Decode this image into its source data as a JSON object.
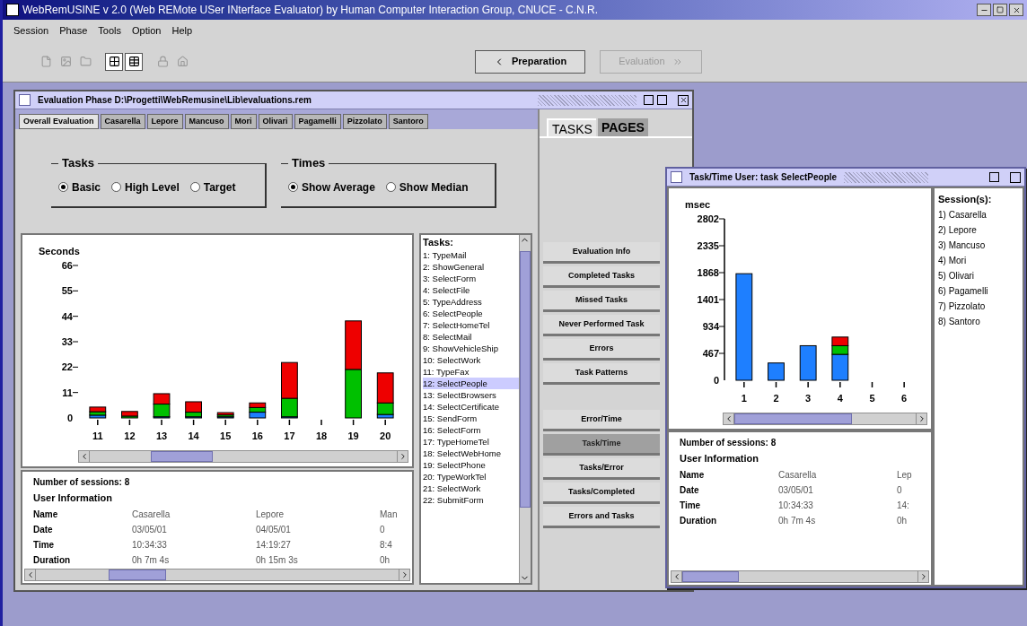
{
  "app": {
    "title": "WebRemUSINE v 2.0 (Web REMote USer INterface Evaluator) by Human Computer Interaction Group, CNUCE - C.N.R.",
    "menu": [
      "Session",
      "Phase",
      "Tools",
      "Option",
      "Help"
    ],
    "toolbar": [
      [
        {
          "disabled": true
        },
        {
          "disabled": true
        },
        {
          "disabled": true
        }
      ],
      [
        {
          "disabled": false
        },
        {
          "disabled": false
        }
      ],
      [
        {
          "disabled": true
        },
        {
          "disabled": true
        }
      ]
    ],
    "phase_buttons": [
      {
        "label": "Preparation",
        "kind": "back",
        "disabled": false
      },
      {
        "label": "Evaluation",
        "kind": "forward",
        "disabled": true
      }
    ]
  },
  "evaluation_window": {
    "title": "Evaluation Phase  D:\\Progetti\\WebRemusine\\Lib\\evaluations.rem",
    "tabs": [
      {
        "label": "Overall Evaluation",
        "selected": true
      },
      {
        "label": "Casarella",
        "selected": false
      },
      {
        "label": "Lepore",
        "selected": false
      },
      {
        "label": "Mancuso",
        "selected": false
      },
      {
        "label": "Mori",
        "selected": false
      },
      {
        "label": "Olivari",
        "selected": false
      },
      {
        "label": "Pagamelli",
        "selected": false
      },
      {
        "label": "Pizzolato",
        "selected": false
      },
      {
        "label": "Santoro",
        "selected": false
      }
    ],
    "tasks_group": {
      "label": "Tasks",
      "options": [
        {
          "label": "Basic",
          "selected": true
        },
        {
          "label": "High Level",
          "selected": false
        },
        {
          "label": "Target",
          "selected": false
        }
      ]
    },
    "times_group": {
      "label": "Times",
      "options": [
        {
          "label": "Show Average",
          "selected": true
        },
        {
          "label": "Show Median",
          "selected": false
        }
      ]
    },
    "chart_data": {
      "type": "bar",
      "stacked": true,
      "ylabel": "Seconds",
      "categories": [
        "11",
        "12",
        "13",
        "14",
        "15",
        "16",
        "17",
        "18",
        "19",
        "20"
      ],
      "ylim": [
        0,
        66
      ],
      "yticks": [
        0,
        11,
        22,
        33,
        44,
        55,
        66
      ],
      "series": [
        {
          "color": "#1e7fff",
          "values": [
            1.2,
            0,
            0.5,
            0.5,
            0.5,
            2.5,
            0.5,
            0,
            0,
            1.5
          ]
        },
        {
          "color": "#00c000",
          "values": [
            1.5,
            0.8,
            5.5,
            2,
            0.8,
            2,
            8,
            0,
            21,
            5
          ]
        },
        {
          "color": "#ee0000",
          "values": [
            2,
            2,
            4.5,
            4.5,
            1,
            2,
            15.5,
            0,
            21,
            13
          ]
        }
      ]
    },
    "task_list": {
      "title": "Tasks:",
      "items": [
        {
          "label": "1: TypeMail",
          "selected": false
        },
        {
          "label": "2: ShowGeneral",
          "selected": false
        },
        {
          "label": "3: SelectForm",
          "selected": false
        },
        {
          "label": "4: SelectFile",
          "selected": false
        },
        {
          "label": "5: TypeAddress",
          "selected": false
        },
        {
          "label": "6: SelectPeople",
          "selected": false
        },
        {
          "label": "7: SelectHomeTel",
          "selected": false
        },
        {
          "label": "8: SelectMail",
          "selected": false
        },
        {
          "label": "9: ShowVehicleShip",
          "selected": false
        },
        {
          "label": "10: SelectWork",
          "selected": false
        },
        {
          "label": "11: TypeFax",
          "selected": false
        },
        {
          "label": "12: SelectPeople",
          "selected": true
        },
        {
          "label": "13: SelectBrowsers",
          "selected": false
        },
        {
          "label": "14: SelectCertificate",
          "selected": false
        },
        {
          "label": "15: SendForm",
          "selected": false
        },
        {
          "label": "16: SelectForm",
          "selected": false
        },
        {
          "label": "17: TypeHomeTel",
          "selected": false
        },
        {
          "label": "18: SelectWebHome",
          "selected": false
        },
        {
          "label": "19: SelectPhone",
          "selected": false
        },
        {
          "label": "20: TypeWorkTel",
          "selected": false
        },
        {
          "label": "21: SelectWork",
          "selected": false
        },
        {
          "label": "22: SubmitForm",
          "selected": false
        }
      ]
    },
    "info": {
      "summary": "Number of sessions: 8",
      "heading": "User Information",
      "rows": [
        {
          "label": "Name",
          "values": [
            "Casarella",
            "Lepore",
            "Man"
          ]
        },
        {
          "label": "Date",
          "values": [
            "03/05/01",
            "04/05/01",
            "0"
          ]
        },
        {
          "label": "Time",
          "values": [
            "10:34:33",
            "14:19:27",
            "8:4"
          ]
        },
        {
          "label": "Duration",
          "values": [
            "0h 7m 4s",
            "0h 15m 3s",
            "0h"
          ]
        }
      ]
    },
    "side_tabs": [
      {
        "label": "TASKS",
        "selected": true
      },
      {
        "label": "PAGES",
        "selected": false
      }
    ],
    "analysis_buttons": [
      {
        "label": "Evaluation Info",
        "selected": false
      },
      {
        "label": "Completed Tasks",
        "selected": false
      },
      {
        "label": "Missed Tasks",
        "selected": false
      },
      {
        "label": "Never Performed Task",
        "selected": false
      },
      {
        "label": "Errors",
        "selected": false
      },
      {
        "label": "Task Patterns",
        "selected": false
      }
    ],
    "chart_buttons": [
      {
        "label": "Error/Time",
        "selected": false
      },
      {
        "label": "Task/Time",
        "selected": true
      },
      {
        "label": "Tasks/Error",
        "selected": false
      },
      {
        "label": "Tasks/Completed",
        "selected": false
      },
      {
        "label": "Errors and Tasks",
        "selected": false
      }
    ]
  },
  "task_time_window": {
    "title": "Task/Time User: task SelectPeople",
    "chart_data": {
      "type": "bar",
      "stacked": true,
      "ylabel": "msec",
      "categories": [
        "1",
        "2",
        "3",
        "4",
        "5",
        "6"
      ],
      "ylim": [
        0,
        2802
      ],
      "yticks": [
        0,
        467,
        934,
        1401,
        1868,
        2335,
        2802
      ],
      "series": [
        {
          "color": "#1e7fff",
          "values": [
            1850,
            300,
            600,
            450,
            0,
            0
          ]
        },
        {
          "color": "#00c000",
          "values": [
            0,
            0,
            0,
            150,
            0,
            0
          ]
        },
        {
          "color": "#ee0000",
          "values": [
            0,
            0,
            0,
            150,
            0,
            0
          ]
        }
      ]
    },
    "info": {
      "summary": "Number of sessions: 8",
      "heading": "User Information",
      "rows": [
        {
          "label": "Name",
          "values": [
            "Casarella",
            "Lep"
          ]
        },
        {
          "label": "Date",
          "values": [
            "03/05/01",
            "0"
          ]
        },
        {
          "label": "Time",
          "values": [
            "10:34:33",
            "14:"
          ]
        },
        {
          "label": "Duration",
          "values": [
            "0h 7m 4s",
            "0h"
          ]
        }
      ]
    },
    "sessions": {
      "title": "Session(s):",
      "items": [
        "1) Casarella",
        "2) Lepore",
        "3) Mancuso",
        "4) Mori",
        "5) Olivari",
        "6) Pagamelli",
        "7) Pizzolato",
        "8) Santoro"
      ]
    }
  }
}
